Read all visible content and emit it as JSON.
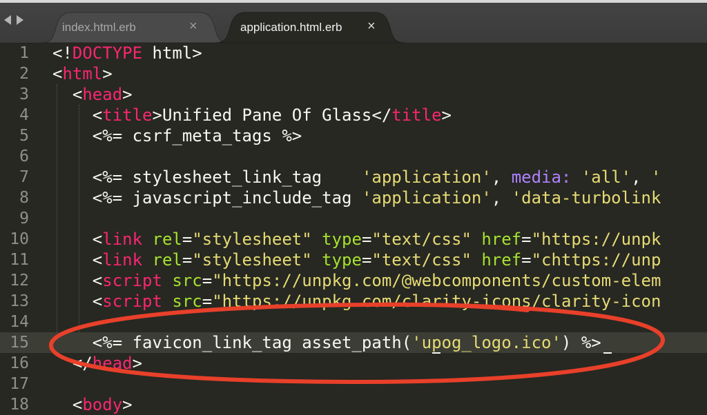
{
  "tabs": [
    {
      "label": "index.html.erb",
      "active": false
    },
    {
      "label": "application.html.erb",
      "active": true
    }
  ],
  "close_glyph": "×",
  "colors": {
    "background": "#272822",
    "tag": "#f92672",
    "string": "#e6db74",
    "attribute": "#a6e22e",
    "symbol": "#ae81ff",
    "text": "#f8f8f2",
    "annotation": "#e8402a"
  },
  "editor": {
    "current_line": 15,
    "lines": [
      {
        "n": "1",
        "tokens": [
          [
            "p",
            "<!"
          ],
          [
            "t",
            "DOCTYPE"
          ],
          [
            "p",
            " html>"
          ]
        ]
      },
      {
        "n": "2",
        "tokens": [
          [
            "p",
            "<"
          ],
          [
            "t",
            "html"
          ],
          [
            "p",
            ">"
          ]
        ]
      },
      {
        "n": "3",
        "tokens": [
          [
            "p",
            "  <"
          ],
          [
            "t",
            "head"
          ],
          [
            "p",
            ">"
          ]
        ]
      },
      {
        "n": "4",
        "tokens": [
          [
            "p",
            "    <"
          ],
          [
            "t",
            "title"
          ],
          [
            "p",
            ">Unified Pane Of Glass</"
          ],
          [
            "t",
            "title"
          ],
          [
            "p",
            ">"
          ]
        ]
      },
      {
        "n": "5",
        "tokens": [
          [
            "p",
            "    <%= csrf_meta_tags %>"
          ]
        ]
      },
      {
        "n": "6",
        "tokens": []
      },
      {
        "n": "7",
        "tokens": [
          [
            "p",
            "    <%= stylesheet_link_tag    "
          ],
          [
            "s",
            "'application'"
          ],
          [
            "p",
            ", "
          ],
          [
            "m",
            "media:"
          ],
          [
            "p",
            " "
          ],
          [
            "s",
            "'all'"
          ],
          [
            "p",
            ", "
          ],
          [
            "s",
            "'"
          ]
        ]
      },
      {
        "n": "8",
        "tokens": [
          [
            "p",
            "    <%= javascript_include_tag "
          ],
          [
            "s",
            "'application'"
          ],
          [
            "p",
            ", "
          ],
          [
            "s",
            "'data-turbolink"
          ]
        ]
      },
      {
        "n": "9",
        "tokens": []
      },
      {
        "n": "10",
        "tokens": [
          [
            "p",
            "    <"
          ],
          [
            "t",
            "link"
          ],
          [
            "p",
            " "
          ],
          [
            "a",
            "rel"
          ],
          [
            "p",
            "="
          ],
          [
            "s",
            "\"stylesheet\""
          ],
          [
            "p",
            " "
          ],
          [
            "a",
            "type"
          ],
          [
            "p",
            "="
          ],
          [
            "s",
            "\"text/css\""
          ],
          [
            "p",
            " "
          ],
          [
            "a",
            "href"
          ],
          [
            "p",
            "="
          ],
          [
            "s",
            "\"https://unpk"
          ]
        ]
      },
      {
        "n": "11",
        "tokens": [
          [
            "p",
            "    <"
          ],
          [
            "t",
            "link"
          ],
          [
            "p",
            " "
          ],
          [
            "a",
            "rel"
          ],
          [
            "p",
            "="
          ],
          [
            "s",
            "\"stylesheet\""
          ],
          [
            "p",
            " "
          ],
          [
            "a",
            "type"
          ],
          [
            "p",
            "="
          ],
          [
            "s",
            "\"text/css\""
          ],
          [
            "p",
            " "
          ],
          [
            "a",
            "href"
          ],
          [
            "p",
            "="
          ],
          [
            "s",
            "\"chttps://unp"
          ]
        ]
      },
      {
        "n": "12",
        "tokens": [
          [
            "p",
            "    <"
          ],
          [
            "t",
            "script"
          ],
          [
            "p",
            " "
          ],
          [
            "a",
            "src"
          ],
          [
            "p",
            "="
          ],
          [
            "s",
            "\"https://unpkg.com/@webcomponents/custom-elem"
          ]
        ]
      },
      {
        "n": "13",
        "tokens": [
          [
            "p",
            "    <"
          ],
          [
            "t",
            "script"
          ],
          [
            "p",
            " "
          ],
          [
            "a",
            "src"
          ],
          [
            "p",
            "="
          ],
          [
            "s",
            "\"https://unpkg.com/clarity-icons/clarity-icon"
          ]
        ]
      },
      {
        "n": "14",
        "tokens": []
      },
      {
        "n": "15",
        "tokens": [
          [
            "p",
            "    <%= favicon_link_tag asset_path("
          ],
          [
            "s",
            "'upog_logo.ico'"
          ],
          [
            "p",
            ") %>"
          ]
        ]
      },
      {
        "n": "16",
        "tokens": [
          [
            "p",
            "  </"
          ],
          [
            "t",
            "head"
          ],
          [
            "p",
            ">"
          ]
        ]
      },
      {
        "n": "17",
        "tokens": []
      },
      {
        "n": "18",
        "tokens": [
          [
            "p",
            "  <"
          ],
          [
            "t",
            "body"
          ],
          [
            "p",
            ">"
          ]
        ]
      }
    ]
  }
}
